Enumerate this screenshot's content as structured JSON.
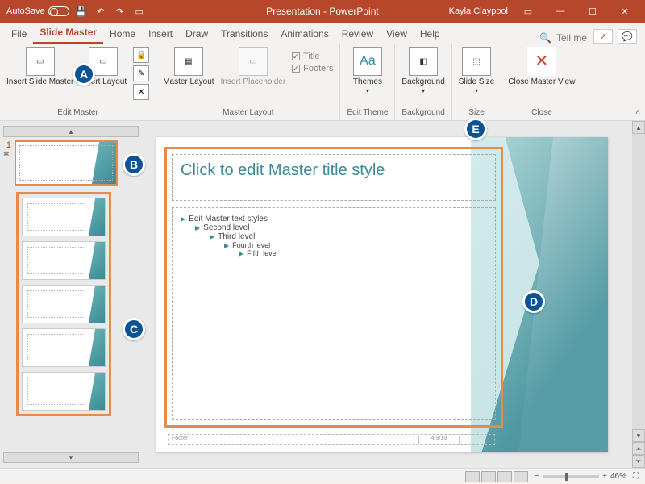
{
  "titlebar": {
    "autosave_label": "AutoSave",
    "autosave_state": "Off",
    "app_title": "Presentation - PowerPoint",
    "user": "Kayla Claypool"
  },
  "tabs": {
    "file": "File",
    "slidemaster": "Slide Master",
    "home": "Home",
    "insert": "Insert",
    "draw": "Draw",
    "transitions": "Transitions",
    "animations": "Animations",
    "review": "Review",
    "view": "View",
    "help": "Help",
    "tellme": "Tell me"
  },
  "ribbon": {
    "edit_master": {
      "insert_slide_master": "Insert Slide Master",
      "insert_layout": "Insert Layout",
      "group_label": "Edit Master"
    },
    "master_layout": {
      "master_layout": "Master Layout",
      "insert_placeholder": "Insert Placeholder",
      "title_chk": "Title",
      "footers_chk": "Footers",
      "group_label": "Master Layout"
    },
    "edit_theme": {
      "themes": "Themes",
      "group_label": "Edit Theme"
    },
    "background": {
      "background": "Background",
      "group_label": "Background"
    },
    "size": {
      "slide_size": "Slide Size",
      "group_label": "Size"
    },
    "close": {
      "close_master_view": "Close Master View",
      "group_label": "Close"
    }
  },
  "slide": {
    "number": "1",
    "title_placeholder": "Click to edit Master title style",
    "body": {
      "l1": "Edit Master text styles",
      "l2": "Second level",
      "l3": "Third level",
      "l4": "Fourth level",
      "l5": "Fifth level"
    },
    "footer_label": "Footer",
    "date_label": "4/9/19"
  },
  "callouts": {
    "a": "A",
    "b": "B",
    "c": "C",
    "d": "D",
    "e": "E"
  },
  "statusbar": {
    "zoom_pct": "46%"
  }
}
